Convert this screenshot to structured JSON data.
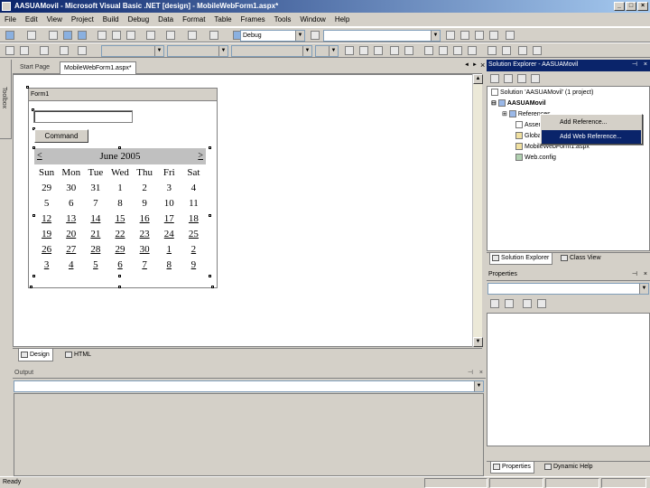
{
  "window": {
    "title": "AASUAMovil - Microsoft Visual Basic .NET [design] - MobileWebForm1.aspx*",
    "minimize": "_",
    "maximize": "□",
    "close": "×"
  },
  "menu": [
    "File",
    "Edit",
    "View",
    "Project",
    "Build",
    "Debug",
    "Data",
    "Format",
    "Table",
    "Frames",
    "Tools",
    "Window",
    "Help"
  ],
  "toolbar": {
    "config_combo": "Debug",
    "find_combo": ""
  },
  "toolbox": {
    "label": "Toolbox"
  },
  "doc_tabs": {
    "start": "Start Page",
    "active": "MobileWebForm1.aspx*",
    "close": "×"
  },
  "designer": {
    "form_title": "Form1",
    "command_label": "Command",
    "calendar": {
      "prev": "<",
      "next": ">",
      "month": "June 2005",
      "days": [
        "Sun",
        "Mon",
        "Tue",
        "Wed",
        "Thu",
        "Fri",
        "Sat"
      ],
      "weeks": [
        [
          "29",
          "30",
          "31",
          "1",
          "2",
          "3",
          "4"
        ],
        [
          "5",
          "6",
          "7",
          "8",
          "9",
          "10",
          "11"
        ],
        [
          "12",
          "13",
          "14",
          "15",
          "16",
          "17",
          "18"
        ],
        [
          "19",
          "20",
          "21",
          "22",
          "23",
          "24",
          "25"
        ],
        [
          "26",
          "27",
          "28",
          "29",
          "30",
          "1",
          "2"
        ],
        [
          "3",
          "4",
          "5",
          "6",
          "7",
          "8",
          "9"
        ]
      ]
    }
  },
  "view_tabs": {
    "design": "Design",
    "html": "HTML"
  },
  "output": {
    "title": "Output"
  },
  "solution_explorer": {
    "title": "Solution Explorer - AASUAMovil",
    "tree": {
      "solution": "Solution 'AASUAMovil' (1 project)",
      "project": "AASUAMovil",
      "references": "References",
      "assembly": "AssemblyInfo.vb",
      "global": "Global.asax",
      "form": "MobileWebForm1.aspx",
      "webconfig": "Web.config"
    },
    "context_menu": [
      "Add Reference...",
      "Add Web Reference..."
    ],
    "tabs": {
      "solution": "Solution Explorer",
      "class": "Class View"
    }
  },
  "properties": {
    "title": "Properties",
    "tabs": {
      "properties": "Properties",
      "help": "Dynamic Help"
    }
  },
  "status": {
    "text": "Ready"
  },
  "colors": {
    "title_active": "#0a246a",
    "face": "#d4d0c8",
    "selection": "#0a246a"
  }
}
